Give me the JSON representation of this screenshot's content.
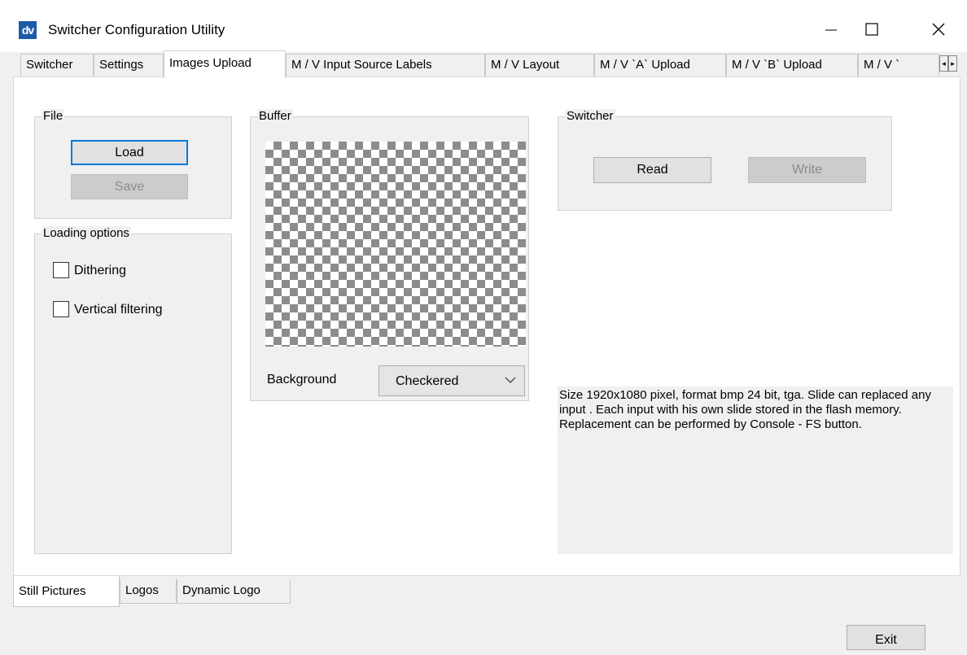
{
  "window": {
    "icon_text": "dv",
    "title": "Switcher Configuration Utility",
    "minimize_glyph": "—",
    "maximize_glyph": "☐",
    "close_glyph": "✕"
  },
  "tabs": [
    {
      "label": "Switcher"
    },
    {
      "label": "Settings"
    },
    {
      "label": "Images Upload",
      "active": true
    },
    {
      "label": "M / V  Input Source Labels"
    },
    {
      "label": "M / V Layout"
    },
    {
      "label": "M / V `A` Upload"
    },
    {
      "label": "M / V `B` Upload"
    },
    {
      "label": "M / V `"
    }
  ],
  "tab_scroll": {
    "left": "◂",
    "right": "▸"
  },
  "file_group": {
    "title": "File",
    "load_label": "Load",
    "save_label": "Save"
  },
  "loading_options": {
    "title": "Loading options",
    "dithering_label": "Dithering",
    "dithering_checked": false,
    "vertical_filtering_label": "Vertical filtering",
    "vertical_filtering_checked": false
  },
  "buffer": {
    "title": "Buffer",
    "background_label": "Background",
    "background_value": "Checkered"
  },
  "switcher_group": {
    "title": "Switcher",
    "read_label": "Read",
    "write_label": "Write"
  },
  "info_text": " Size 1920x1080 pixel, format bmp 24 bit, tga. Slide can replaced any input . Each input with his own slide stored in the flash memory. Replacement can be performed by Console - FS button.",
  "bottom_tabs": [
    {
      "label": "Still Pictures",
      "active": true
    },
    {
      "label": "Logos"
    },
    {
      "label": "Dynamic Logo"
    }
  ],
  "exit_label": "Exit",
  "colors": {
    "accent": "#0078d7",
    "icon_bg": "#1e5aa8"
  }
}
